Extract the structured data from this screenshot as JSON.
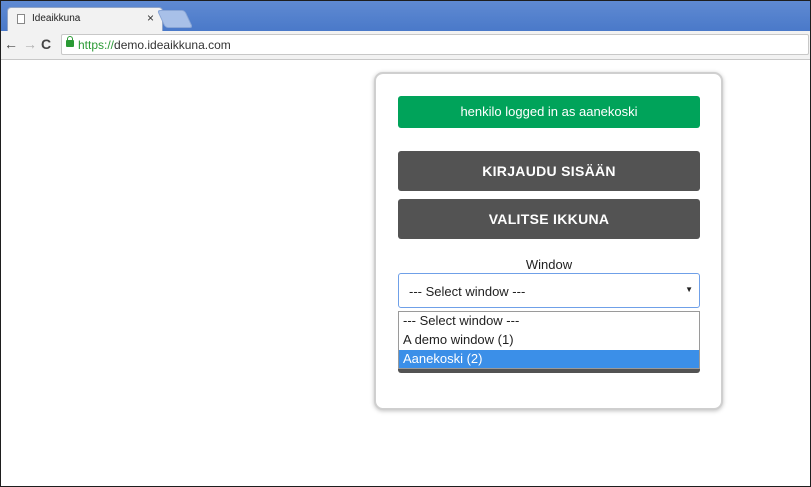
{
  "browser": {
    "tab_title": "Ideaikkuna",
    "tab_close": "×",
    "url_scheme": "https://",
    "url_host": "demo.ideaikkuna.com",
    "icons": [
      "page-icon",
      "close-icon",
      "back-icon",
      "forward-icon",
      "reload-icon",
      "lock-icon"
    ]
  },
  "panel": {
    "status_message": "henkilo logged in as aanekoski",
    "login_button": "KIRJAUDU SISÄÄN",
    "select_window_button": "VALITSE IKKUNA",
    "window_label": "Window",
    "window_select": {
      "selected": "--- Select window ---",
      "options": [
        "--- Select window ---",
        "A demo window (1)",
        "Aanekoski (2)"
      ],
      "highlighted": "Aanekoski (2)"
    }
  },
  "colors": {
    "status_green": "#00a35a",
    "button_dark": "#535353",
    "highlight_blue": "#3b8fe8",
    "tabstrip_blue": "#4a79c9"
  }
}
